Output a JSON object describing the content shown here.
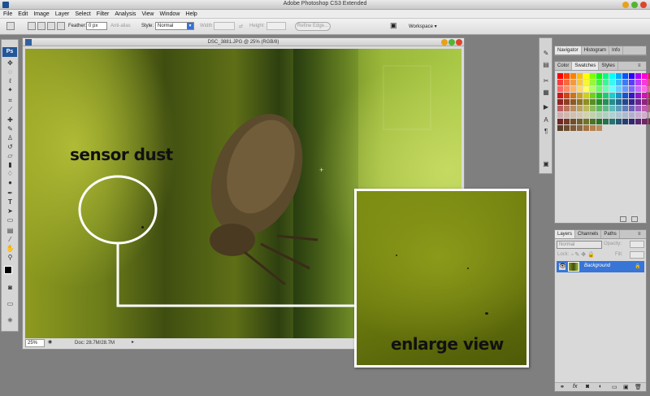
{
  "app": {
    "title": "Adobe Photoshop CS3 Extended"
  },
  "menu": [
    "File",
    "Edit",
    "Image",
    "Layer",
    "Select",
    "Filter",
    "Analysis",
    "View",
    "Window",
    "Help"
  ],
  "options": {
    "feather_label": "Feather:",
    "feather_value": "0 px",
    "antialias_label": "Anti-alias",
    "style_label": "Style:",
    "style_value": "Normal",
    "width_label": "Width:",
    "height_label": "Height:",
    "refine_edge": "Refine Edge...",
    "workspace": "Workspace"
  },
  "toolbox": {
    "logo": "Ps"
  },
  "document": {
    "title": "DSC_3881.JPG @ 25% (RGB/8)",
    "zoom": "25%",
    "doc_size": "Doc: 28.7M/28.7M"
  },
  "annotations": {
    "sensor_dust": "sensor dust",
    "enlarge_view": "enlarge view"
  },
  "panels": {
    "nav_tabs": [
      "Navigator",
      "Histogram",
      "Info"
    ],
    "swatch_tabs": [
      "Color",
      "Swatches",
      "Styles"
    ],
    "layer_tabs": [
      "Layers",
      "Channels",
      "Paths"
    ],
    "blend_mode": "Normal",
    "opacity_label": "Opacity:",
    "lock_label": "Lock:",
    "fill_label": "Fill:",
    "layer_name": "Background"
  },
  "colors": {
    "accent": "#3875d7",
    "ps_blue": "#24579a",
    "close_btn": "#e0442c",
    "min_btn": "#e6a21c",
    "max_btn": "#53b434"
  }
}
